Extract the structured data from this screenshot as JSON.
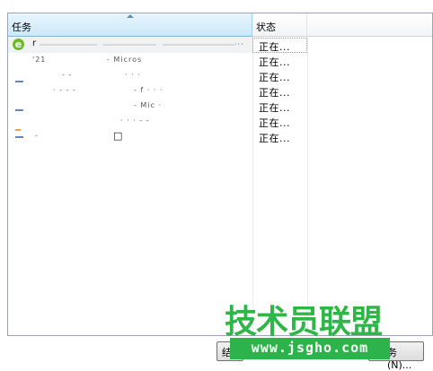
{
  "list": {
    "columns": {
      "task": "任务",
      "status": "状态"
    },
    "rows": [
      {
        "task_lead": "r",
        "task_trail": "···",
        "status": "正在..."
      },
      {
        "task_lead": "'21",
        "task_mid": "- Micros",
        "status": "正在..."
      },
      {
        "task_lead": "- -",
        "task_mid": "· · ·",
        "status": "正在..."
      },
      {
        "task_lead": "·  - - -",
        "task_mid": "-  f · · ·",
        "status": "正在..."
      },
      {
        "task_lead": "",
        "task_mid": "- Mic  ·",
        "status": "正在..."
      },
      {
        "task_lead": "",
        "task_mid": "· ·  ·  - -",
        "status": "正在..."
      },
      {
        "task_lead": "-",
        "task_mid": "□",
        "status": "正在..."
      }
    ]
  },
  "buttons": {
    "left_partial": "结",
    "right_partial": "务 (N)..."
  },
  "watermark": {
    "title": "技术员联盟",
    "url": "www.jsgho.com"
  }
}
